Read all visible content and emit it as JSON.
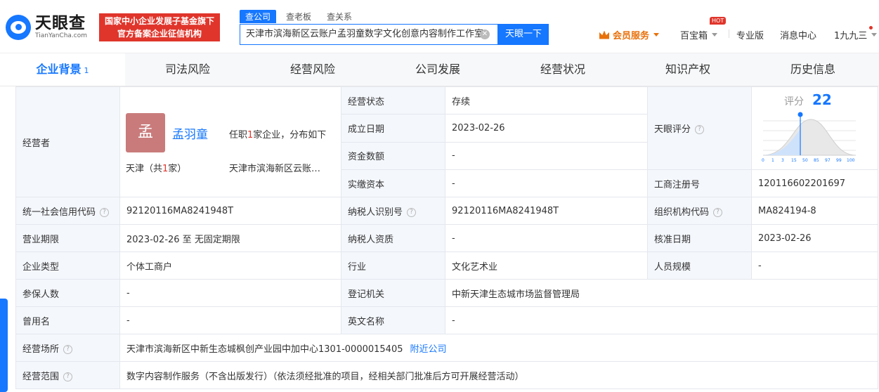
{
  "header": {
    "logo_cn": "天眼查",
    "logo_en": "TianYanCha.com",
    "badge_line1": "国家中小企业发展子基金旗下",
    "badge_line2": "官方备案企业征信机构",
    "search_tabs": [
      "查公司",
      "查老板",
      "查关系"
    ],
    "search_value": "天津市滨海新区云账户孟羽童数字文化创意内容制作工作室",
    "search_button": "天眼一下",
    "vip": "会员服务",
    "treasure": "百宝箱",
    "hot": "HOT",
    "pro": "专业版",
    "messages": "消息中心",
    "user": "1九九三"
  },
  "tabs": [
    {
      "label": "企业背景",
      "count": "1"
    },
    {
      "label": "司法风险"
    },
    {
      "label": "经营风险"
    },
    {
      "label": "公司发展"
    },
    {
      "label": "经营状况"
    },
    {
      "label": "知识产权"
    },
    {
      "label": "历史信息"
    }
  ],
  "owner": {
    "label": "经营者",
    "avatar": "孟",
    "name": "孟羽童",
    "role_prefix": "任职",
    "role_count": "1",
    "role_suffix": "家企业，分布如下",
    "loc_prefix": "天津（共",
    "loc_count": "1",
    "loc_suffix": "家）",
    "company": "天津市滨海新区云账户孟羽童数字文化创意内容制作工作室"
  },
  "score": {
    "label": "天眼评分",
    "title": "评分",
    "value": "22",
    "axis": [
      "0",
      "1",
      "3",
      "15",
      "50",
      "85",
      "97",
      "99",
      "100"
    ]
  },
  "rows": {
    "status": {
      "label": "经营状态",
      "value": "存续"
    },
    "founded": {
      "label": "成立日期",
      "value": "2023-02-26"
    },
    "capital": {
      "label": "资金数额",
      "value": "-"
    },
    "paid": {
      "label": "实缴资本",
      "value": "-"
    },
    "reg_no": {
      "label": "工商注册号",
      "value": "120116602201697"
    },
    "credit_code": {
      "label": "统一社会信用代码",
      "value": "92120116MA8241948T"
    },
    "taxpayer_id": {
      "label": "纳税人识别号",
      "value": "92120116MA8241948T"
    },
    "org_code": {
      "label": "组织机构代码",
      "value": "MA824194-8"
    },
    "term": {
      "label": "营业期限",
      "value": "2023-02-26 至 无固定期限"
    },
    "tax_qual": {
      "label": "纳税人资质",
      "value": "-"
    },
    "approve_date": {
      "label": "核准日期",
      "value": "2023-02-26"
    },
    "type": {
      "label": "企业类型",
      "value": "个体工商户"
    },
    "industry": {
      "label": "行业",
      "value": "文化艺术业"
    },
    "staff": {
      "label": "人员规模",
      "value": "-"
    },
    "insured": {
      "label": "参保人数",
      "value": "-"
    },
    "authority": {
      "label": "登记机关",
      "value": "中新天津生态城市场监督管理局"
    },
    "former": {
      "label": "曾用名",
      "value": "-"
    },
    "english": {
      "label": "英文名称",
      "value": "-"
    },
    "address": {
      "label": "经营场所",
      "value": "天津市滨海新区中新生态城枫创产业园中加中心1301-0000015405",
      "link": "附近公司"
    },
    "scope": {
      "label": "经营范围",
      "value": "数字内容制作服务（不含出版发行）（依法须经批准的项目，经相关部门批准后方可开展经营活动）"
    }
  }
}
